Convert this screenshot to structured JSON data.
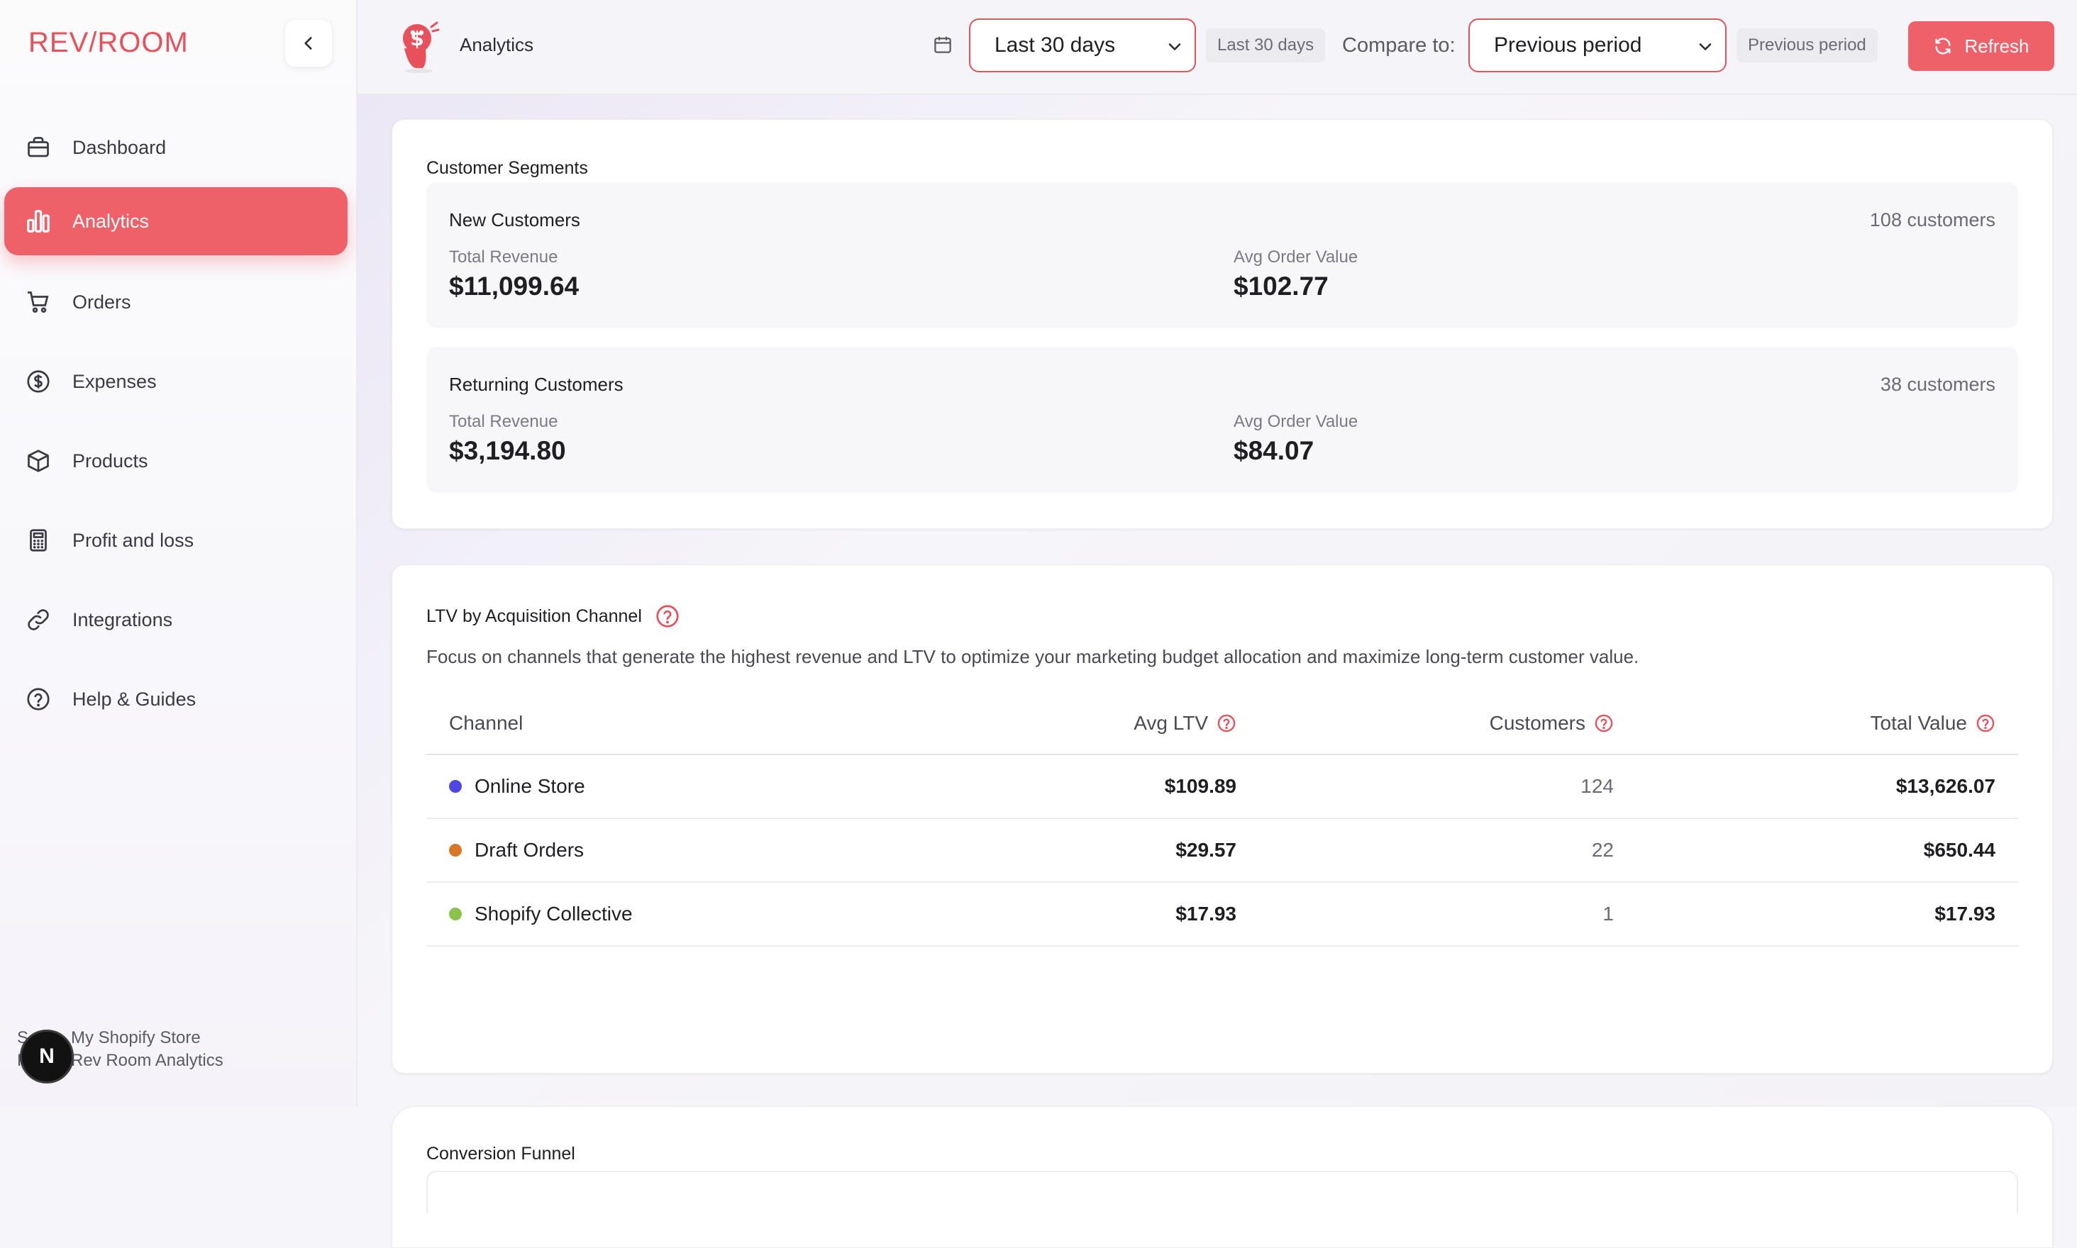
{
  "brand": {
    "logo_text": "REV/ROOM",
    "accent": "#ef6169"
  },
  "sidebar": {
    "items": [
      {
        "label": "Dashboard",
        "icon": "briefcase-icon"
      },
      {
        "label": "Analytics",
        "icon": "bar-chart-icon",
        "active": true
      },
      {
        "label": "Orders",
        "icon": "cart-icon"
      },
      {
        "label": "Expenses",
        "icon": "dollar-circle-icon"
      },
      {
        "label": "Products",
        "icon": "box-icon"
      },
      {
        "label": "Profit and loss",
        "icon": "calculator-icon"
      },
      {
        "label": "Integrations",
        "icon": "link-icon"
      },
      {
        "label": "Help & Guides",
        "icon": "help-circle-icon"
      }
    ],
    "store": {
      "badge": "N",
      "line1_prefix": "S",
      "line1": "My Shopify Store",
      "line2_prefix": "Pl",
      "line2": "Rev Room Analytics"
    }
  },
  "header": {
    "title": "Analytics",
    "date_range": {
      "selected": "Last 30 days",
      "chip": "Last 30 days"
    },
    "compare": {
      "label": "Compare to:",
      "selected": "Previous period",
      "chip": "Previous period"
    },
    "refresh_label": "Refresh"
  },
  "segments": {
    "title": "Customer Segments",
    "items": [
      {
        "name": "New Customers",
        "count": "108 customers",
        "revenue_label": "Total Revenue",
        "revenue": "$11,099.64",
        "aov_label": "Avg Order Value",
        "aov": "$102.77"
      },
      {
        "name": "Returning Customers",
        "count": "38 customers",
        "revenue_label": "Total Revenue",
        "revenue": "$3,194.80",
        "aov_label": "Avg Order Value",
        "aov": "$84.07"
      }
    ]
  },
  "ltv": {
    "title": "LTV by Acquisition Channel",
    "description": "Focus on channels that generate the highest revenue and LTV to optimize your marketing budget allocation and maximize long-term customer value.",
    "columns": [
      "Channel",
      "Avg LTV",
      "Customers",
      "Total Value"
    ],
    "rows": [
      {
        "channel": "Online Store",
        "color": "#4f46e5",
        "avg_ltv": "$109.89",
        "customers": "124",
        "total": "$13,626.07"
      },
      {
        "channel": "Draft Orders",
        "color": "#d97727",
        "avg_ltv": "$29.57",
        "customers": "22",
        "total": "$650.44"
      },
      {
        "channel": "Shopify Collective",
        "color": "#8bc34a",
        "avg_ltv": "$17.93",
        "customers": "1",
        "total": "$17.93"
      }
    ]
  },
  "funnel": {
    "title": "Conversion Funnel"
  }
}
